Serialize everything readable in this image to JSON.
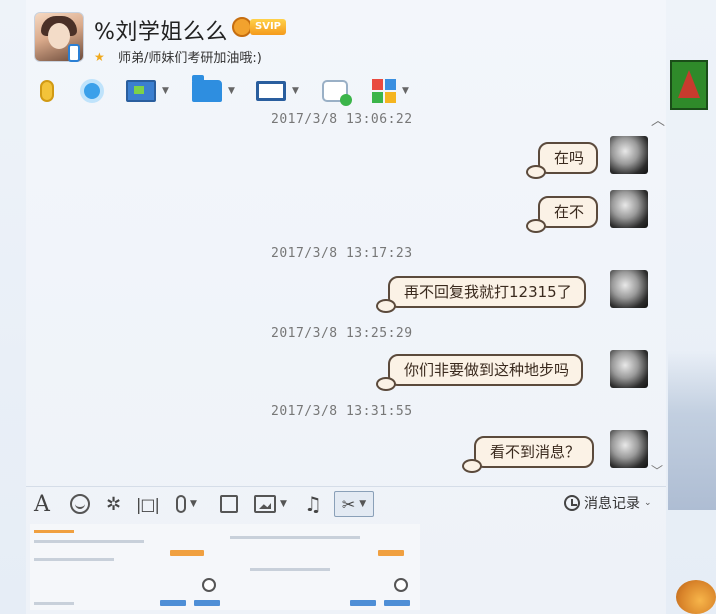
{
  "header": {
    "contact_name": "%刘学姐么么",
    "vip_label": "SVIP",
    "signature": "师弟/师妹们考研加油哦:)"
  },
  "toolbar": {
    "items": [
      "voice-call",
      "video-call",
      "remote-desktop",
      "send-file",
      "share-screen",
      "create-discussion",
      "apps"
    ]
  },
  "messages": [
    {
      "type": "timestamp",
      "text": "2017/3/8 13:06:22"
    },
    {
      "type": "message",
      "text": "在吗"
    },
    {
      "type": "message",
      "text": "在不"
    },
    {
      "type": "timestamp",
      "text": "2017/3/8 13:17:23"
    },
    {
      "type": "message",
      "text": "再不回复我就打12315了"
    },
    {
      "type": "timestamp",
      "text": "2017/3/8 13:25:29"
    },
    {
      "type": "message",
      "text": "你们非要做到这种地步吗"
    },
    {
      "type": "timestamp",
      "text": "2017/3/8 13:31:55"
    },
    {
      "type": "message",
      "text": "看不到消息？"
    }
  ],
  "input_toolbar": {
    "font_glyph": "A",
    "history_label": "消息记录"
  },
  "colors": {
    "bubble_bg": "#fbf2e6",
    "bubble_border": "#5b4a3c",
    "window_bg": "#eef2f8"
  }
}
